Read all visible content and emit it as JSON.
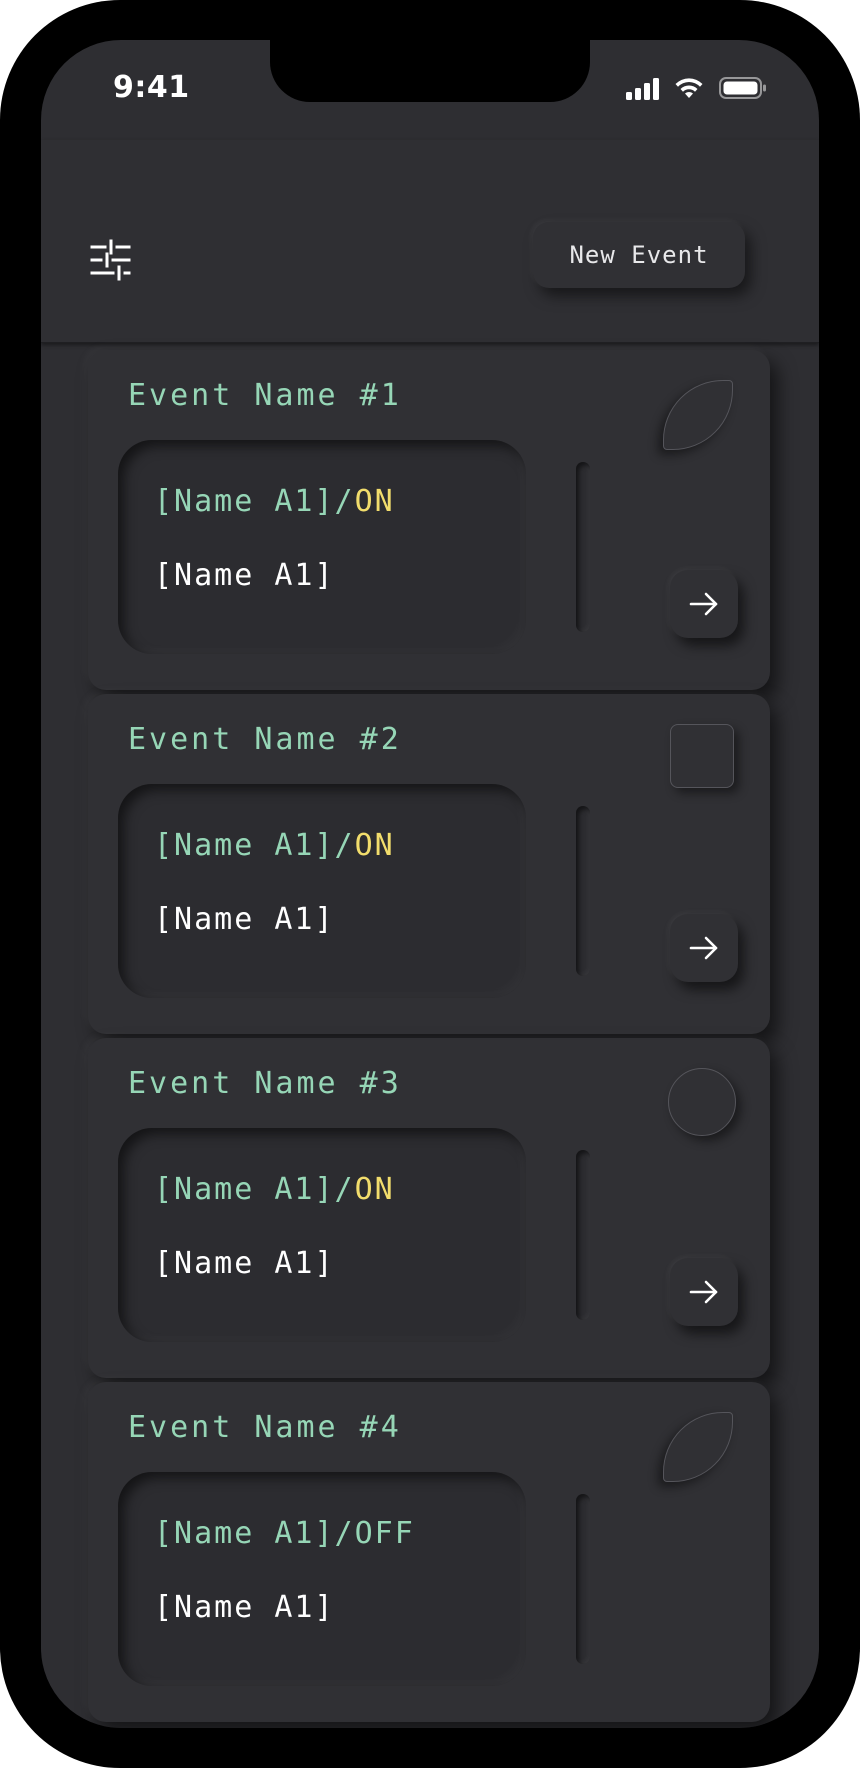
{
  "status_bar": {
    "time": "9:41",
    "icons": [
      "signal-icon",
      "wifi-icon",
      "battery-icon"
    ]
  },
  "header": {
    "filter_icon": "sliders-icon",
    "new_event_label": "New Event"
  },
  "colors": {
    "accent_green": "#96d6b6",
    "accent_yellow": "#f2dd6c",
    "background": "#2e2e32"
  },
  "events": [
    {
      "title": "Event Name #1",
      "status_name": "[Name A1]/",
      "status_value": "ON",
      "name": "[Name A1]",
      "shape": "leaf"
    },
    {
      "title": "Event Name #2",
      "status_name": "[Name A1]/",
      "status_value": "ON",
      "name": "[Name A1]",
      "shape": "square"
    },
    {
      "title": "Event Name #3",
      "status_name": "[Name A1]/",
      "status_value": "ON",
      "name": "[Name A1]",
      "shape": "circle"
    },
    {
      "title": "Event Name #4",
      "status_name": "[Name A1]/",
      "status_value": "OFF",
      "name": "[Name A1]",
      "shape": "leaf"
    }
  ]
}
